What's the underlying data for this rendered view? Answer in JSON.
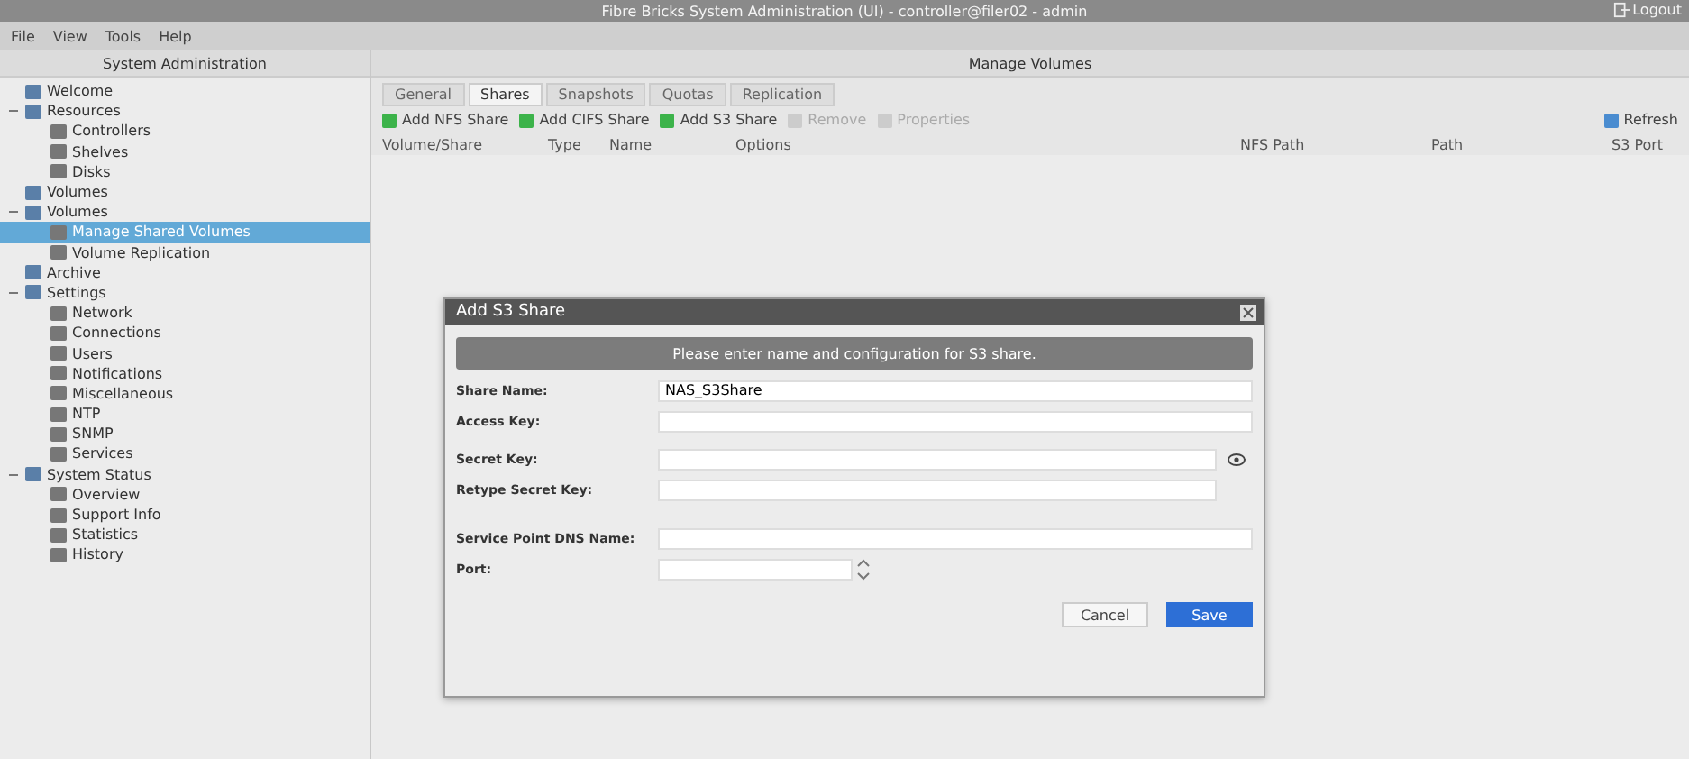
{
  "window": {
    "title": "Fibre Bricks System Administration (UI) - controller@filer02 - admin",
    "logout": "Logout"
  },
  "menu": [
    "File",
    "View",
    "Tools",
    "Help"
  ],
  "sidebar": {
    "title": "System Administration",
    "items": [
      {
        "label": "Welcome",
        "selected": false
      },
      {
        "label": "Resources",
        "selected": false,
        "expanded": true,
        "children": [
          {
            "label": "Controllers",
            "selected": false
          },
          {
            "label": "Shelves",
            "selected": false
          },
          {
            "label": "Disks",
            "selected": false
          }
        ]
      },
      {
        "label": "Volumes",
        "selected": false
      },
      {
        "label": "Volumes",
        "selected": false,
        "expanded": true,
        "children": [
          {
            "label": "Manage Shared Volumes",
            "selected": true
          },
          {
            "label": "Volume Replication",
            "selected": false
          }
        ]
      },
      {
        "label": "Archive",
        "selected": false
      },
      {
        "label": "Settings",
        "selected": false,
        "expanded": true,
        "children": [
          {
            "label": "Network",
            "selected": false
          },
          {
            "label": "Connections",
            "selected": false
          },
          {
            "label": "Users",
            "selected": false
          },
          {
            "label": "Notifications",
            "selected": false
          },
          {
            "label": "Miscellaneous",
            "selected": false
          },
          {
            "label": "NTP",
            "selected": false
          },
          {
            "label": "SNMP",
            "selected": false
          },
          {
            "label": "Services",
            "selected": false
          }
        ]
      },
      {
        "label": "System Status",
        "selected": false,
        "expanded": true,
        "children": [
          {
            "label": "Overview",
            "selected": false
          },
          {
            "label": "Support Info",
            "selected": false
          },
          {
            "label": "Statistics",
            "selected": false
          },
          {
            "label": "History",
            "selected": false
          }
        ]
      }
    ]
  },
  "main": {
    "title": "Manage Volumes",
    "tabs": [
      {
        "label": "General",
        "selected": false
      },
      {
        "label": "Shares",
        "selected": true
      },
      {
        "label": "Snapshots",
        "selected": false
      },
      {
        "label": "Quotas",
        "selected": false
      },
      {
        "label": "Replication",
        "selected": false
      }
    ],
    "toolbar": [
      {
        "label": "Add NFS Share",
        "disabled": false
      },
      {
        "label": "Add CIFS Share",
        "disabled": false
      },
      {
        "label": "Add S3 Share",
        "disabled": false
      },
      {
        "label": "Remove",
        "disabled": true
      },
      {
        "label": "Properties",
        "disabled": true
      }
    ],
    "refresh": "Refresh",
    "columns": [
      "Volume/Share",
      "Type",
      "Name",
      "Options",
      "NFS Path",
      "Path",
      "S3 Port"
    ]
  },
  "dialog": {
    "title": "Add S3 Share",
    "banner": "Please enter name and configuration for S3 share.",
    "fields": [
      {
        "label": "Share Name:",
        "value": "NAS_S3Share",
        "kind": "text"
      },
      {
        "label": "Access Key:",
        "kind": "text"
      },
      {
        "label": "Secret Key:",
        "kind": "secret"
      },
      {
        "label": "Retype Secret Key:",
        "kind": "plain"
      },
      {
        "label": "Service Point DNS Name:",
        "kind": "text"
      },
      {
        "label": "Port:",
        "kind": "spin"
      }
    ],
    "buttons": [
      {
        "label": "Cancel",
        "kind": "secondary"
      },
      {
        "label": "Save",
        "kind": "primary"
      }
    ]
  }
}
